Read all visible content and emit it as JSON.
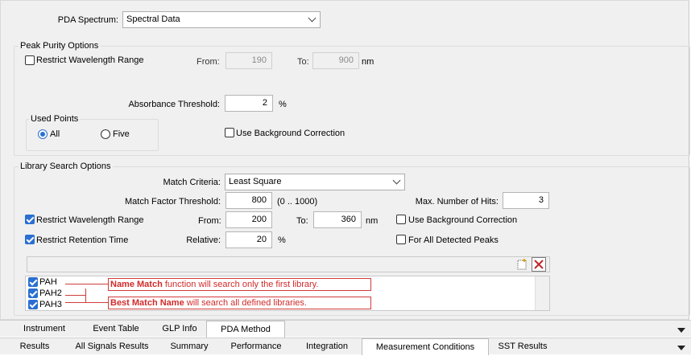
{
  "pda": {
    "label": "PDA Spectrum:",
    "value": "Spectral Data"
  },
  "peak_purity": {
    "title": "Peak Purity Options",
    "restrict_wavelength_label": "Restrict Wavelength Range",
    "restrict_wavelength_checked": false,
    "from_label": "From:",
    "from_value": "190",
    "to_label": "To:",
    "to_value": "900",
    "unit": "nm",
    "absorbance_label": "Absorbance Threshold:",
    "absorbance_value": "2",
    "absorbance_unit": "%",
    "used_points": {
      "title": "Used Points",
      "all_label": "All",
      "five_label": "Five",
      "selected": "All"
    },
    "background_label": "Use Background Correction",
    "background_checked": false
  },
  "library": {
    "title": "Library Search Options",
    "match_criteria_label": "Match Criteria:",
    "match_criteria_value": "Least Square",
    "match_factor_label": "Match Factor Threshold:",
    "match_factor_value": "800",
    "match_factor_range": "(0 .. 1000)",
    "max_hits_label": "Max. Number of Hits:",
    "max_hits_value": "3",
    "restrict_wavelength_label": "Restrict Wavelength Range",
    "restrict_wavelength_checked": true,
    "from_label": "From:",
    "from_value": "200",
    "to_label": "To:",
    "to_value": "360",
    "unit": "nm",
    "background_label": "Use Background Correction",
    "background_checked": false,
    "restrict_rt_label": "Restrict Retention Time",
    "restrict_rt_checked": true,
    "relative_label": "Relative:",
    "relative_value": "20",
    "relative_unit": "%",
    "all_peaks_label": "For All Detected Peaks",
    "all_peaks_checked": false,
    "libraries": [
      {
        "name": "PAH",
        "checked": true
      },
      {
        "name": "PAH2",
        "checked": true
      },
      {
        "name": "PAH3",
        "checked": true
      }
    ],
    "callouts": [
      {
        "bold": "Name Match",
        "rest": " function will search only the first library."
      },
      {
        "bold": "Best Match Name",
        "rest": " will search all defined libraries."
      }
    ]
  },
  "tabs_top": [
    "Instrument",
    "Event Table",
    "GLP Info",
    "PDA Method"
  ],
  "tabs_top_active": "PDA Method",
  "tabs_bottom": [
    "Results",
    "All Signals Results",
    "Summary",
    "Performance",
    "Integration",
    "Measurement Conditions",
    "SST Results"
  ],
  "tabs_bottom_active": "Measurement Conditions",
  "icons": {
    "new": "new-item-icon",
    "delete": "delete-icon",
    "dropdown": "chevron-down-icon"
  },
  "colors": {
    "accent": "#2a6fd1",
    "callout": "#d12a2a",
    "delete": "#c0262c"
  }
}
